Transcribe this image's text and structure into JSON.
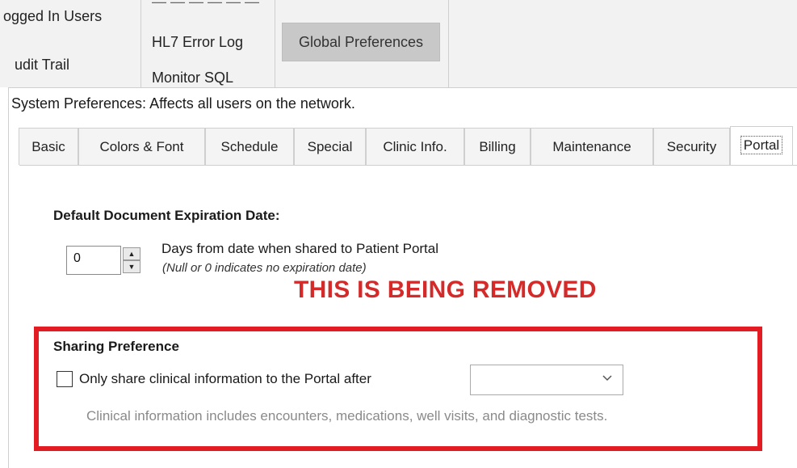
{
  "toolbar": {
    "items": [
      {
        "label": "ogged In Users"
      },
      {
        "label": "udit Trail"
      },
      {
        "label": "HL7 Error Log"
      },
      {
        "label": "Monitor SQL"
      }
    ],
    "active_button": "Global Preferences"
  },
  "dialog": {
    "title": "System Preferences: Affects all users on the network.",
    "tabs": [
      {
        "label": "Basic"
      },
      {
        "label": "Colors & Font"
      },
      {
        "label": "Schedule"
      },
      {
        "label": "Special"
      },
      {
        "label": "Clinic Info."
      },
      {
        "label": "Billing"
      },
      {
        "label": "Maintenance"
      },
      {
        "label": "Security"
      },
      {
        "label": "Portal"
      }
    ],
    "active_tab": "Portal"
  },
  "expiration": {
    "heading": "Default Document Expiration Date:",
    "value": "0",
    "description": "Days from date when shared to Patient Portal",
    "hint": "(Null or 0 indicates no expiration date)"
  },
  "annotation": {
    "label": "THIS IS BEING REMOVED",
    "color": "#e31b23"
  },
  "sharing": {
    "heading": "Sharing Preference",
    "checkbox_label": "Only share clinical information to the Portal after",
    "checked": false,
    "dropdown_value": "",
    "note": "Clinical information includes encounters, medications, well visits, and diagnostic tests."
  },
  "icons": {
    "spin_up": "spin-up-arrow-icon",
    "spin_down": "spin-down-arrow-icon",
    "dropdown": "chevron-down-icon"
  }
}
